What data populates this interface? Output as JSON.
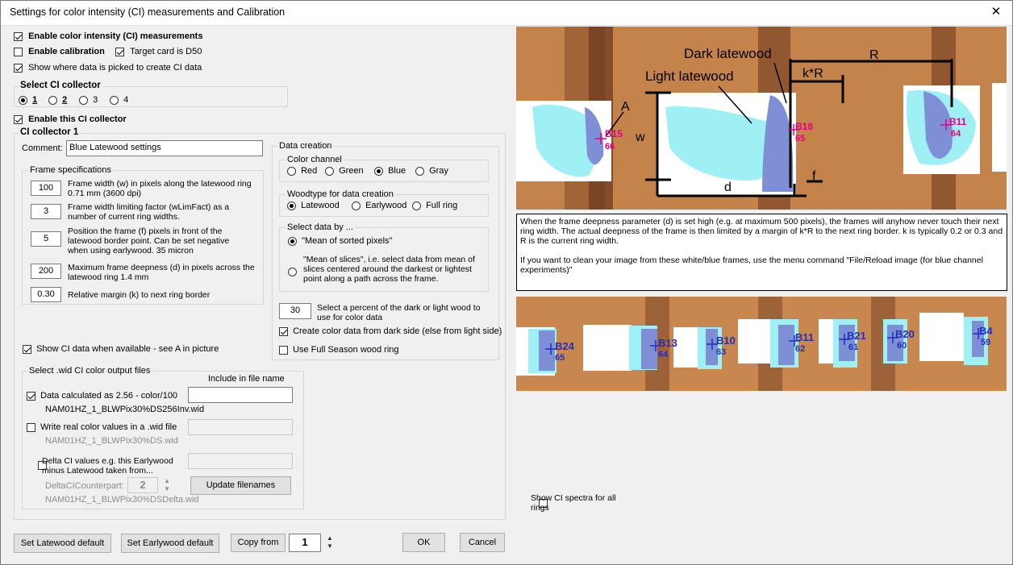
{
  "window": {
    "title": "Settings for color intensity (CI) measurements and Calibration",
    "close": "✕"
  },
  "top_options": {
    "enable_ci": "Enable color intensity (CI) measurements",
    "enable_calibration": "Enable calibration",
    "target_card": "Target card is D50",
    "show_where": "Show where data is picked to create CI data"
  },
  "collector_select": {
    "title": "Select CI collector",
    "options": [
      "1",
      "2",
      "3",
      "4"
    ],
    "selected": "1"
  },
  "enable_collector": "Enable this CI collector",
  "collector": {
    "title": "CI collector 1",
    "comment_label": "Comment:",
    "comment_value": "Blue Latewood settings"
  },
  "frame": {
    "title": "Frame specifications",
    "rows": [
      {
        "value": "100",
        "label": "Frame width (w) in pixels along the latewood ring 0.71 mm   (3600 dpi)"
      },
      {
        "value": "3",
        "label": "Frame width limiting factor (wLimFact) as a number of current ring widths."
      },
      {
        "value": "5",
        "label": "Position the frame (f)  pixels in front of the latewood border point. Can be set negative when using earlywood.  35 micron"
      },
      {
        "value": "200",
        "label": "Maximum frame deepness (d) in pixels across the latewood ring 1.4 mm"
      },
      {
        "value": "0.30",
        "label": "Relative margin (k) to next ring border"
      }
    ]
  },
  "data_creation": {
    "title": "Data creation",
    "channel_title": "Color channel",
    "channels": [
      "Red",
      "Green",
      "Blue",
      "Gray"
    ],
    "channel_selected": "Blue",
    "woodtype_title": "Woodtype for data creation",
    "woodtypes": [
      "Latewood",
      "Earlywood",
      "Full ring"
    ],
    "woodtype_selected": "Latewood",
    "select_title": "Select data by ...",
    "select_opt1": "\"Mean of sorted pixels\"",
    "select_opt2": "\"Mean of slices\", i.e. select data from mean of slices centered  around the darkest or lightest point along a path across the frame.",
    "percent_value": "30",
    "percent_label": "Select a percent of the dark or light wood to use for color data",
    "dark_side": "Create color data from dark side (else from light side)",
    "full_season": "Use Full Season wood ring"
  },
  "show_ci_data": "Show CI data when available - see A in picture",
  "output": {
    "title": "Select .wid CI color output files",
    "include_header": "Include in file name",
    "item1_label": "Data calculated as 2.56 - color/100",
    "item1_file": "NAM01HZ_1_BLWPix30%DS256Inv.wid",
    "item2_label": "Write real color values in a .wid file",
    "item2_file": "NAM01HZ_1_BLWPix30%DS.wid",
    "item3_label": "Delta CI values e.g. this Earlywood minus Latewood taken from...",
    "counterpart_label": "DeltaCICounterpart:",
    "counterpart_value": "2",
    "update_btn": "Update filenames",
    "item3_file": "NAM01HZ_1_BLWPix30%DSDelta.wid"
  },
  "bottom": {
    "latewood_default": "Set Latewood default",
    "earlywood_default": "Set Earlywood default",
    "copy_from": "Copy from",
    "copy_value": "1",
    "ok": "OK",
    "cancel": "Cancel"
  },
  "diagram": {
    "dark_latewood": "Dark latewood",
    "light_latewood": "Light latewood",
    "A": "A",
    "w": "w",
    "d": "d",
    "f": "f",
    "kR": "k*R",
    "R": "R",
    "markers": [
      {
        "name": "B15",
        "value": "66"
      },
      {
        "name": "B18",
        "value": "65"
      },
      {
        "name": "B11",
        "value": "64"
      }
    ]
  },
  "info_text": {
    "p1": "When the frame deepness parameter (d) is set high (e.g. at maximum 500 pixels), the frames will anyhow never touch their next ring width. The actual deepness of the frame is then limited by a margin of k*R to the next ring border. k is typically 0.2 or 0.3 and R is the current ring width.",
    "p2": "If you want to clean your image from these white/blue frames, use the menu command  \"File/Reload image (for blue channel experiments)\""
  },
  "strip_markers": [
    {
      "name": "B24",
      "value": "65"
    },
    {
      "name": "B13",
      "value": "64"
    },
    {
      "name": "B10",
      "value": "63"
    },
    {
      "name": "B11",
      "value": "62"
    },
    {
      "name": "B21",
      "value": "61"
    },
    {
      "name": "B20",
      "value": "60"
    },
    {
      "name": "B4",
      "value": "59"
    }
  ],
  "show_spectra": "Show CI spectra for all rings",
  "colors": {
    "wood": "#c8874f",
    "dark_band": "#7a4426",
    "frame_blue": "#7f8fd6",
    "frame_cyan": "#9ff0f5",
    "pink": "#e6007e",
    "blue_label": "#1f2fbf"
  }
}
